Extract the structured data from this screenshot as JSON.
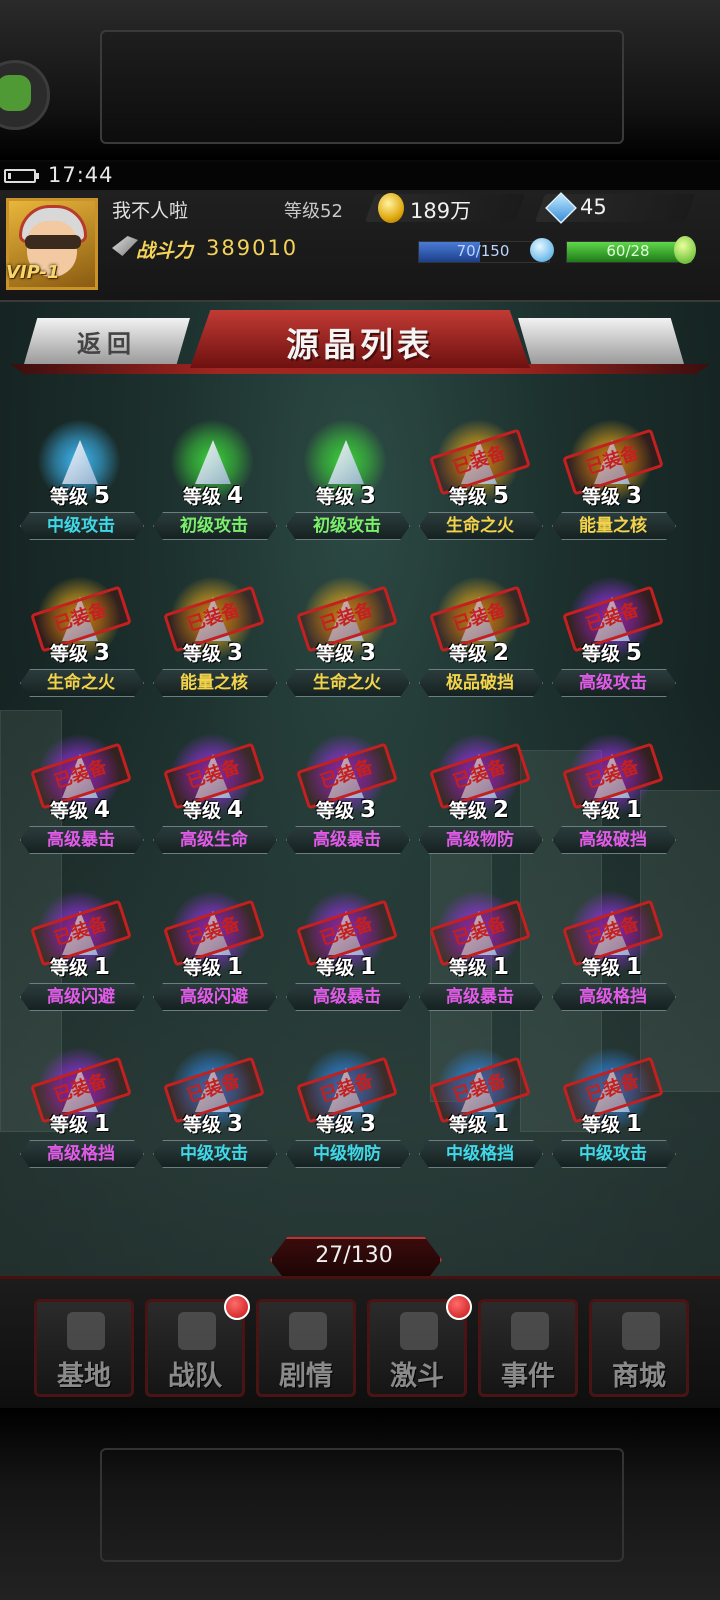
{
  "status_bar": {
    "time": "17:44"
  },
  "player": {
    "name": "我不人啦",
    "level_label": "等级52",
    "gold": "189万",
    "gems": "45",
    "vip": "VIP-1",
    "power_label": "战斗力",
    "power_value": "389010",
    "energy": {
      "text": "70/150",
      "fraction": 0.4667
    },
    "stamina": {
      "text": "60/28",
      "fraction": 1.0
    }
  },
  "header": {
    "title": "源晶列表",
    "back_label": "返回"
  },
  "stamp_label": "已装备",
  "level_prefix": "等级",
  "crystals": [
    {
      "level": "5",
      "name": "中级攻击",
      "color": "#3db8f5",
      "equipped": false,
      "name_color": "#3fd8e8"
    },
    {
      "level": "4",
      "name": "初级攻击",
      "color": "#3cd23a",
      "equipped": false,
      "name_color": "#7af06a"
    },
    {
      "level": "3",
      "name": "初级攻击",
      "color": "#3cd23a",
      "equipped": false,
      "name_color": "#7af06a"
    },
    {
      "level": "5",
      "name": "生命之火",
      "color": "#e8a818",
      "equipped": true,
      "name_color": "#f2d34a"
    },
    {
      "level": "3",
      "name": "能量之核",
      "color": "#e8a818",
      "equipped": true,
      "name_color": "#f2d34a"
    },
    {
      "level": "3",
      "name": "生命之火",
      "color": "#e8a818",
      "equipped": true,
      "name_color": "#f2d34a"
    },
    {
      "level": "3",
      "name": "能量之核",
      "color": "#e8a818",
      "equipped": true,
      "name_color": "#f2d34a"
    },
    {
      "level": "3",
      "name": "生命之火",
      "color": "#e8a818",
      "equipped": true,
      "name_color": "#f2d34a"
    },
    {
      "level": "2",
      "name": "极品破挡",
      "color": "#e8a818",
      "equipped": true,
      "name_color": "#f2d34a"
    },
    {
      "level": "5",
      "name": "高级攻击",
      "color": "#9a30e8",
      "equipped": true,
      "name_color": "#e25ae8"
    },
    {
      "level": "4",
      "name": "高级暴击",
      "color": "#9a30e8",
      "equipped": true,
      "name_color": "#e25ae8"
    },
    {
      "level": "4",
      "name": "高级生命",
      "color": "#9a30e8",
      "equipped": true,
      "name_color": "#e25ae8"
    },
    {
      "level": "3",
      "name": "高级暴击",
      "color": "#9a30e8",
      "equipped": true,
      "name_color": "#e25ae8"
    },
    {
      "level": "2",
      "name": "高级物防",
      "color": "#9a30e8",
      "equipped": true,
      "name_color": "#e25ae8"
    },
    {
      "level": "1",
      "name": "高级破挡",
      "color": "#9a30e8",
      "equipped": true,
      "name_color": "#e25ae8"
    },
    {
      "level": "1",
      "name": "高级闪避",
      "color": "#9a30e8",
      "equipped": true,
      "name_color": "#e25ae8"
    },
    {
      "level": "1",
      "name": "高级闪避",
      "color": "#9a30e8",
      "equipped": true,
      "name_color": "#e25ae8"
    },
    {
      "level": "1",
      "name": "高级暴击",
      "color": "#9a30e8",
      "equipped": true,
      "name_color": "#e25ae8"
    },
    {
      "level": "1",
      "name": "高级暴击",
      "color": "#9a30e8",
      "equipped": true,
      "name_color": "#e25ae8"
    },
    {
      "level": "1",
      "name": "高级格挡",
      "color": "#9a30e8",
      "equipped": true,
      "name_color": "#e25ae8"
    },
    {
      "level": "1",
      "name": "高级格挡",
      "color": "#9a30e8",
      "equipped": true,
      "name_color": "#e25ae8"
    },
    {
      "level": "3",
      "name": "中级攻击",
      "color": "#2f88e8",
      "equipped": true,
      "name_color": "#3fd8e8"
    },
    {
      "level": "3",
      "name": "中级物防",
      "color": "#2f88e8",
      "equipped": true,
      "name_color": "#3fd8e8"
    },
    {
      "level": "1",
      "name": "中级格挡",
      "color": "#2f88e8",
      "equipped": true,
      "name_color": "#3fd8e8"
    },
    {
      "level": "1",
      "name": "中级攻击",
      "color": "#2f88e8",
      "equipped": true,
      "name_color": "#3fd8e8"
    }
  ],
  "pagination": {
    "text": "27/130"
  },
  "nav": [
    {
      "label": "基地",
      "badge": false
    },
    {
      "label": "战队",
      "badge": true
    },
    {
      "label": "剧情",
      "badge": false
    },
    {
      "label": "激斗",
      "badge": true
    },
    {
      "label": "事件",
      "badge": false
    },
    {
      "label": "商城",
      "badge": false
    }
  ]
}
